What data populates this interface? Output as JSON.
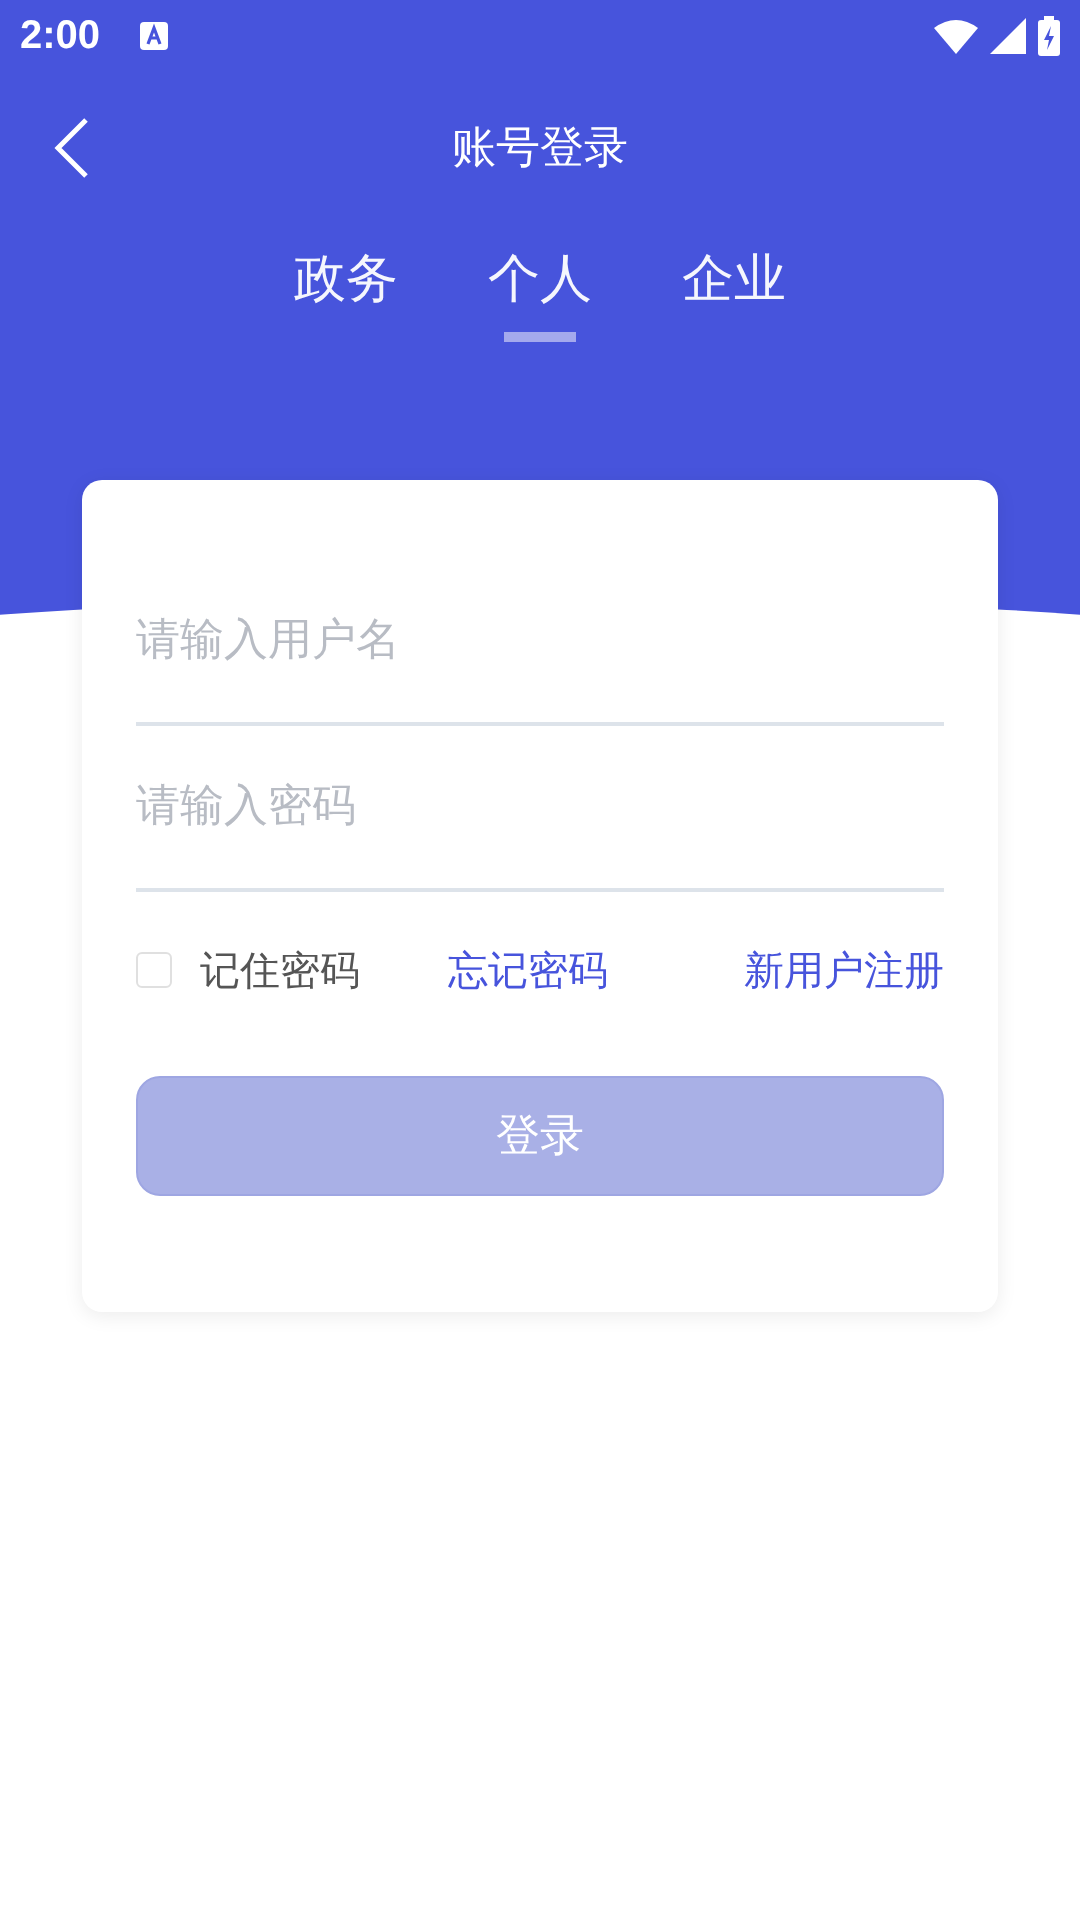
{
  "status_bar": {
    "time": "2:00"
  },
  "nav": {
    "title": "账号登录"
  },
  "tabs": [
    {
      "label": "政务",
      "selected": false
    },
    {
      "label": "个人",
      "selected": true
    },
    {
      "label": "企业",
      "selected": false
    }
  ],
  "form": {
    "username": {
      "placeholder": "请输入用户名"
    },
    "password": {
      "placeholder": "请输入密码"
    },
    "remember": {
      "label": "记住密码",
      "checked": false
    },
    "forgot_link": "忘记密码",
    "register_link": "新用户注册",
    "login_button": {
      "label": "登录",
      "disabled": true
    }
  }
}
